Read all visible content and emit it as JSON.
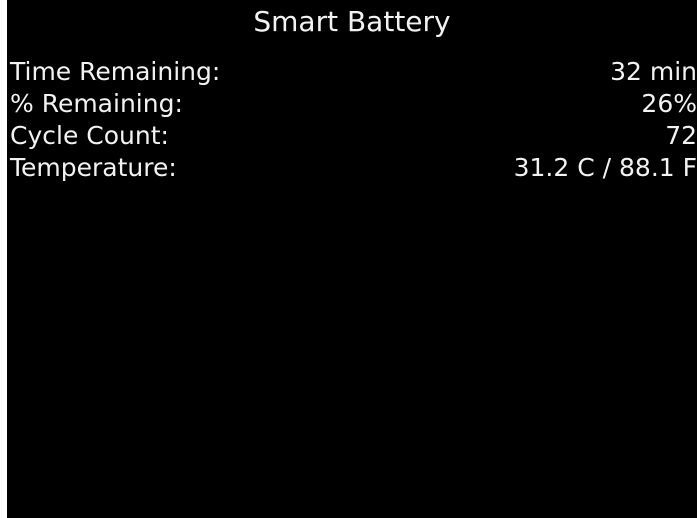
{
  "screen": {
    "title": "Smart Battery",
    "rows": [
      {
        "label": "Time Remaining:",
        "value": "32 min"
      },
      {
        "label": "% Remaining:",
        "value": "26%"
      },
      {
        "label": "Cycle Count:",
        "value": "72"
      },
      {
        "label": "Temperature:",
        "value": "31.2 C / 88.1 F"
      }
    ]
  },
  "colors": {
    "background": "#000000",
    "text": "#ffffff"
  }
}
